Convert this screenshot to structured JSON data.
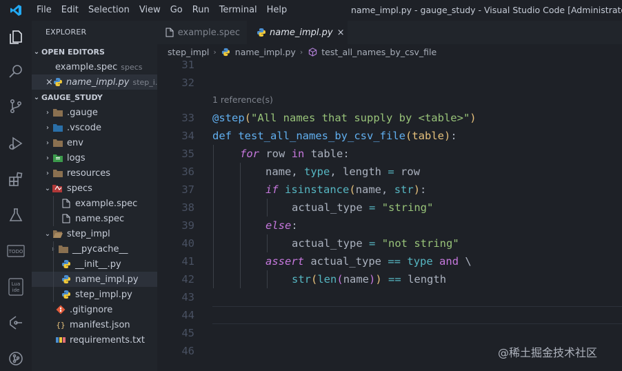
{
  "window": {
    "title": "name_impl.py - gauge_study - Visual Studio Code [Administrator]",
    "menu": [
      "File",
      "Edit",
      "Selection",
      "View",
      "Go",
      "Run",
      "Terminal",
      "Help"
    ]
  },
  "activity_bar": [
    "explorer-icon",
    "search-icon",
    "source-control-icon",
    "run-debug-icon",
    "extensions-icon",
    "testing-icon",
    "todo-icon",
    "lua-ide-icon",
    "gitlens-icon",
    "git-graph-icon"
  ],
  "sidebar": {
    "title": "EXPLORER",
    "open_editors": {
      "label": "OPEN EDITORS",
      "items": [
        {
          "name": "example.spec",
          "hint": "specs"
        },
        {
          "name": "name_impl.py",
          "hint": "step_i..."
        }
      ]
    },
    "workspace": {
      "label": "GAUGE_STUDY",
      "tree": [
        ".gauge",
        ".vscode",
        "env",
        "logs",
        "resources",
        "specs",
        "example.spec",
        "name.spec",
        "step_impl",
        "__pycache__",
        "__init__.py",
        "name_impl.py",
        "step_impl.py",
        ".gitignore",
        "manifest.json",
        "requirements.txt"
      ]
    }
  },
  "tabs": [
    {
      "label": "example.spec",
      "active": false
    },
    {
      "label": "name_impl.py",
      "active": true,
      "close": "×"
    }
  ],
  "breadcrumb": [
    "step_impl",
    "name_impl.py",
    "test_all_names_by_csv_file"
  ],
  "editor": {
    "codelens": "1 reference(s)",
    "line_numbers": [
      "31",
      "32",
      "33",
      "34",
      "35",
      "36",
      "37",
      "38",
      "39",
      "40",
      "41",
      "42",
      "43",
      "44",
      "45",
      "46"
    ],
    "current_line": "44",
    "code": {
      "l33_decorator": "@step",
      "l33_string": "\"All names that supply by <table>\"",
      "l34_def": "def",
      "l34_fn": "test_all_names_by_csv_file",
      "l34_param": "table",
      "l35_for": "for",
      "l35_row": "row",
      "l35_in": "in",
      "l35_table": "table",
      "l36_name": "name",
      "l36_type": "type",
      "l36_length": "length",
      "l36_row": "row",
      "l37_if": "if",
      "l37_isinstance": "isinstance",
      "l37_name": "name",
      "l37_str": "str",
      "l38_var": "actual_type",
      "l38_val": "\"string\"",
      "l39_else": "else",
      "l40_var": "actual_type",
      "l40_val": "\"not string\"",
      "l41_assert": "assert",
      "l41_var": "actual_type",
      "l41_type": "type",
      "l41_and": "and",
      "l42_str": "str",
      "l42_len": "len",
      "l42_name": "name",
      "l42_length": "length"
    }
  },
  "watermark": "@稀土掘金技术社区",
  "colors": {
    "background": "#1e2127",
    "sidebar": "#21252b",
    "keyword": "#c678dd",
    "function": "#61afef",
    "string": "#98c379",
    "parameter": "#e5c07b",
    "builtin": "#56b6c2",
    "vscode_blue": "#23a9f2"
  }
}
